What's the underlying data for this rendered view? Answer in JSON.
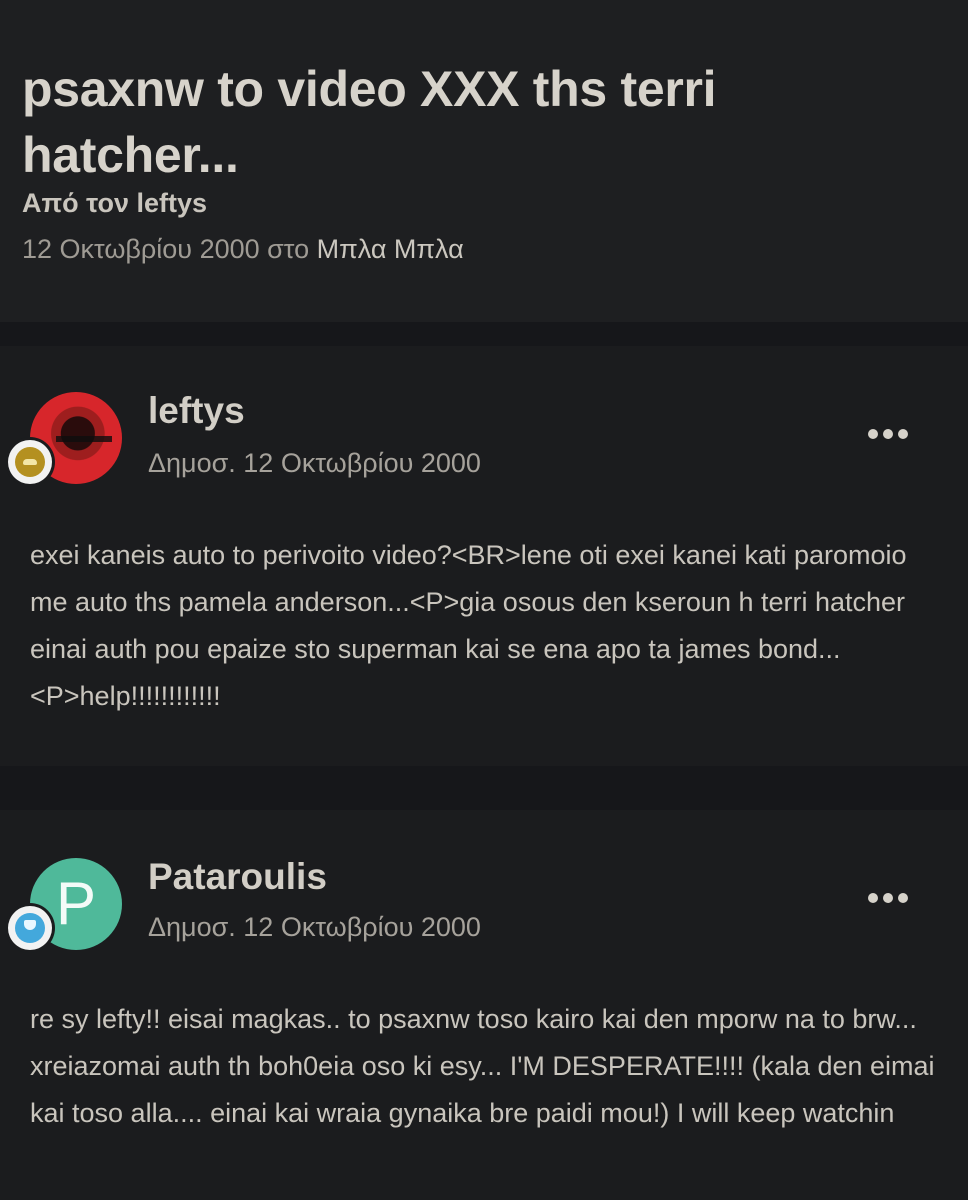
{
  "thread": {
    "title": "psaxnw to video XXX ths terri hatcher...",
    "author_line": "Από τον leftys",
    "date_prefix": "12 Οκτωβρίου 2000 στο ",
    "forum": "Μπλα Μπλα"
  },
  "posts": [
    {
      "author": "leftys",
      "date": "Δημοσ. 12 Οκτωβρίου 2000",
      "avatar": "che-portrait-avatar",
      "badge_icon": "rank-badge-gold-icon",
      "body": "exei kaneis auto to perivoito video?<BR>lene oti exei kanei kati paromoio me auto ths pamela anderson...<P>gia osous den kseroun h terri hatcher einai auth pou epaize sto superman kai se ena apo ta james bond...<P>help!!!!!!!!!!!!"
    },
    {
      "author": "Pataroulis",
      "date": "Δημοσ. 12 Οκτωβρίου 2000",
      "avatar_letter": "P",
      "avatar_color": "#4fb99a",
      "badge_icon": "rank-badge-blue-icon",
      "body": "re sy lefty!! eisai magkas.. to psaxnw toso kairo kai den mporw na to brw... xreiazomai auth th boh0eia oso ki esy... I'M DESPERATE!!!! (kala den eimai kai toso alla.... einai kai wraia gynaika bre paidi mou!) I will keep watchin"
    }
  ],
  "colors": {
    "background": "#1b1c1e",
    "section_gap": "#16171a",
    "text": "#c9c5bd",
    "muted_text": "#a6a29b"
  }
}
